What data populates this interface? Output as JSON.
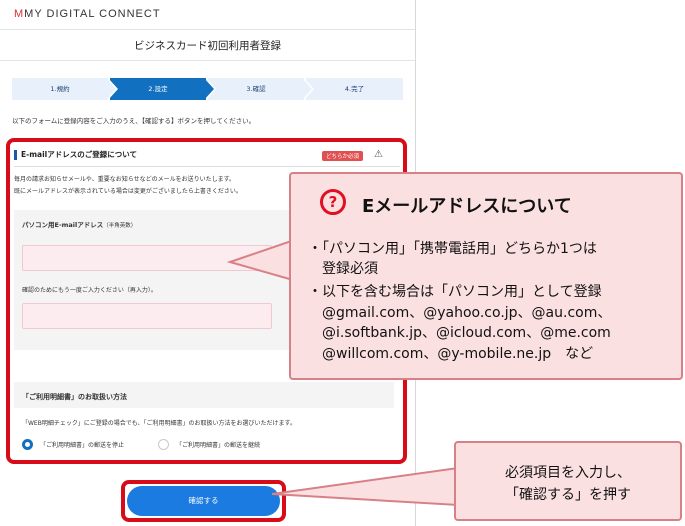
{
  "logo": {
    "text": "MY DIGITAL CONNECT"
  },
  "page": {
    "title": "ビジネスカード初回利用者登録",
    "steps": [
      "1.規約",
      "2.設定",
      "3.確認",
      "4.完了"
    ],
    "instruction": "以下のフォームに登録内容をご入力のうえ、【確認する】ボタンを押してください。"
  },
  "email_section": {
    "title": "E-mailアドレスのご登録について",
    "badge": "どちらか必須",
    "desc1": "毎月の請求お知らせメールや、重要なお知らせなどのメールをお送りいたします。",
    "desc2": "既にメールアドレスが表示されている場合は変更がございましたら上書きください。",
    "pc_label": "パソコン用E-mailアドレス",
    "pc_note": "（半角英数）",
    "confirm_label": "確認のためにもう一度ご入力ください（再入力）。"
  },
  "statement_section": {
    "title": "「ご利用明細書」のお取扱い方法",
    "desc": "「WEB明細チェック」にご登録の場合でも、「ご利用明細書」のお取扱い方法をお選びいただけます。",
    "option1": "「ご利用明細書」の郵送を停止",
    "option2": "「ご利用明細書」の郵送を継続",
    "selected": "option1"
  },
  "confirm_button": {
    "label": "確認する"
  },
  "callout_email": {
    "icon": "question-icon",
    "title": "Eメールアドレスについて",
    "lines": [
      "・「パソコン用」「携帯電話用」どちらか1つは",
      "登録必須",
      "・以下を含む場合は「パソコン用」として登録",
      "@gmail.com、@yahoo.co.jp、@au.com、",
      "@i.softbank.jp、@icloud.com、@me.com",
      "@willcom.com、@y-mobile.ne.jp　など"
    ]
  },
  "callout_button": {
    "lines": [
      "必須項目を入力し、",
      "「確認する」を押す"
    ]
  },
  "colors": {
    "accent": "#1170c0",
    "highlight": "#d80c18",
    "callout_bg": "#fbe0e2"
  }
}
